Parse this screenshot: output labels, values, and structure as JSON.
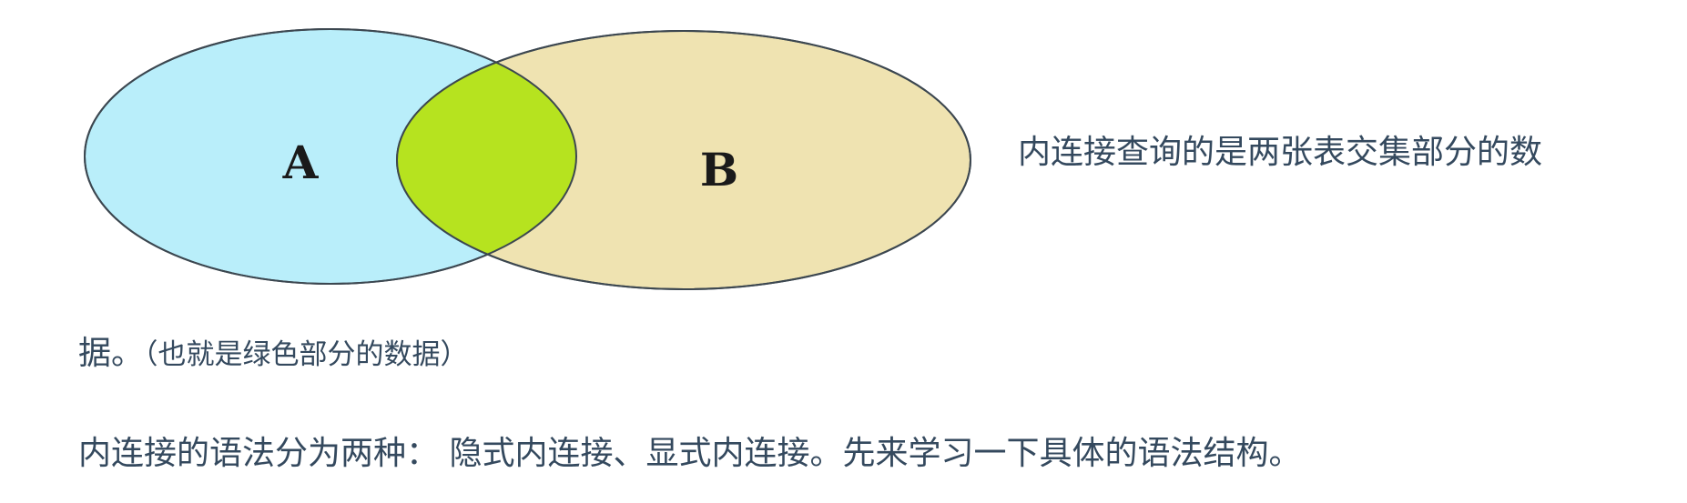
{
  "venn": {
    "set_a_label": "A",
    "set_b_label": "B",
    "colors": {
      "set_a_fill": "#b9eefa",
      "set_b_fill": "#efe3b1",
      "intersection_fill": "#b6e31f",
      "outline": "#3c4750"
    }
  },
  "text": {
    "line1": "内连接查询的是两张表交集部分的数",
    "line2_main": "据。",
    "line2_note": "（也就是绿色部分的数据）",
    "line3": "内连接的语法分为两种： 隐式内连接、显式内连接。先来学习一下具体的语法结构。"
  }
}
